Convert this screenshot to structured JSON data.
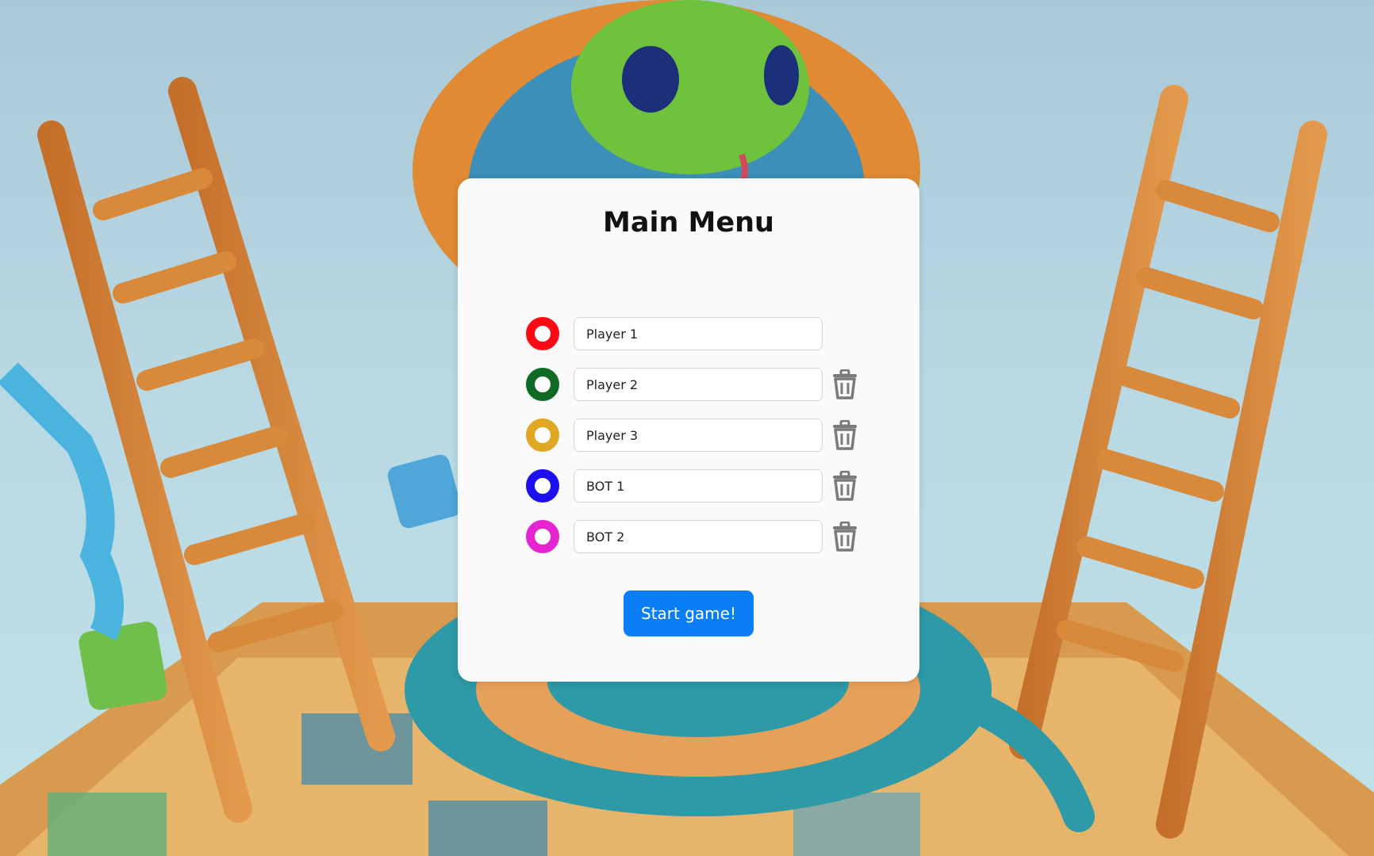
{
  "menu": {
    "title": "Main Menu",
    "players": [
      {
        "color": "#ff0a14",
        "name": "Player 1",
        "removable": false
      },
      {
        "color": "#0f6b24",
        "name": "Player 2",
        "removable": true
      },
      {
        "color": "#e0a723",
        "name": "Player 3",
        "removable": true
      },
      {
        "color": "#1e0ff0",
        "name": "BOT 1",
        "removable": true
      },
      {
        "color": "#e624d2",
        "name": "BOT 2",
        "removable": true
      }
    ],
    "delete_icon": "trash-icon",
    "start_label": "Start game!"
  },
  "theme": {
    "accent": "#0a7ef7",
    "card_bg": "#fafafa"
  }
}
